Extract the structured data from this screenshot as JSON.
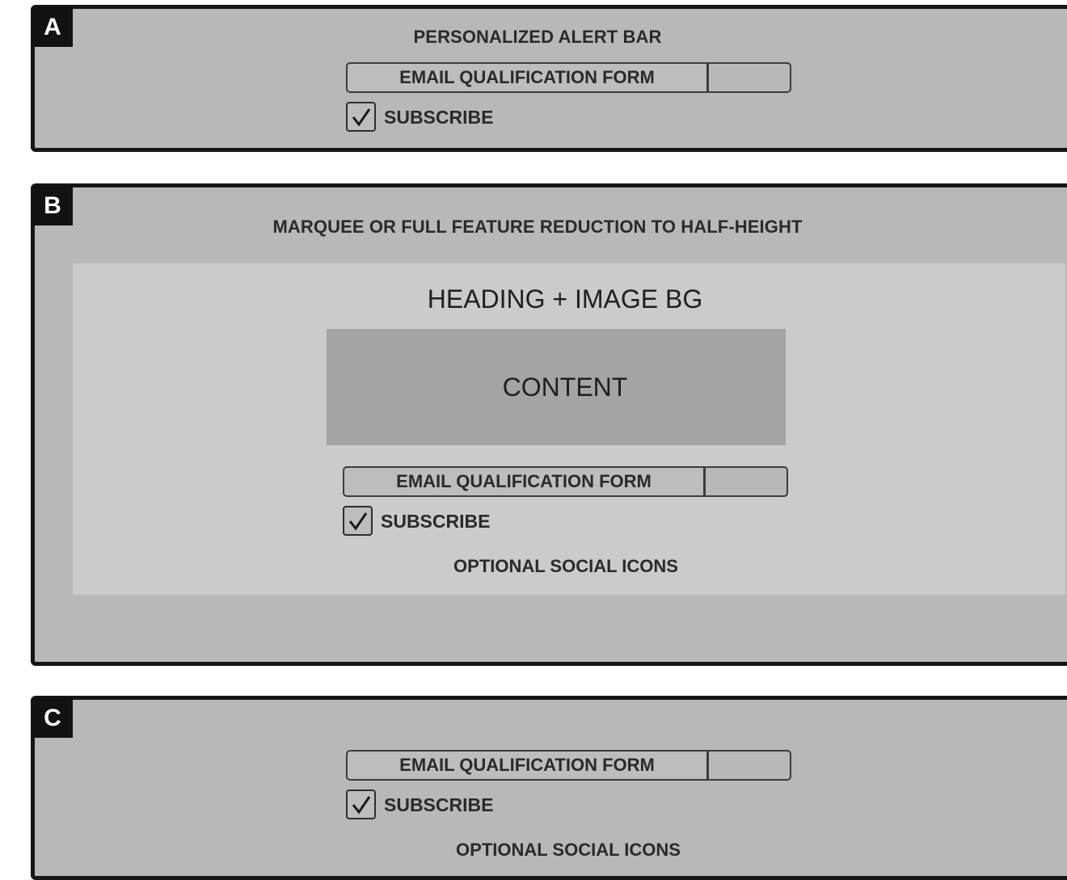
{
  "panels": {
    "a": {
      "badge": "A",
      "title": "PERSONALIZED ALERT BAR",
      "form": {
        "email_label": "EMAIL QUALIFICATION FORM",
        "subscribe_label": "SUBSCRIBE",
        "subscribe_checked": true
      }
    },
    "b": {
      "badge": "B",
      "title": "MARQUEE OR FULL FEATURE REDUCTION TO HALF-HEIGHT",
      "heading": "HEADING + IMAGE BG",
      "content_label": "CONTENT",
      "form": {
        "email_label": "EMAIL QUALIFICATION FORM",
        "subscribe_label": "SUBSCRIBE",
        "subscribe_checked": true
      },
      "social_label": "OPTIONAL SOCIAL ICONS"
    },
    "c": {
      "badge": "C",
      "form": {
        "email_label": "EMAIL QUALIFICATION FORM",
        "subscribe_label": "SUBSCRIBE",
        "subscribe_checked": true
      },
      "social_label": "OPTIONAL SOCIAL ICONS"
    }
  },
  "colors": {
    "panel_bg": "#b8b8b8",
    "panel_border": "#161616",
    "feature_bg": "#cbcbcb",
    "content_bg": "#a4a4a4"
  }
}
